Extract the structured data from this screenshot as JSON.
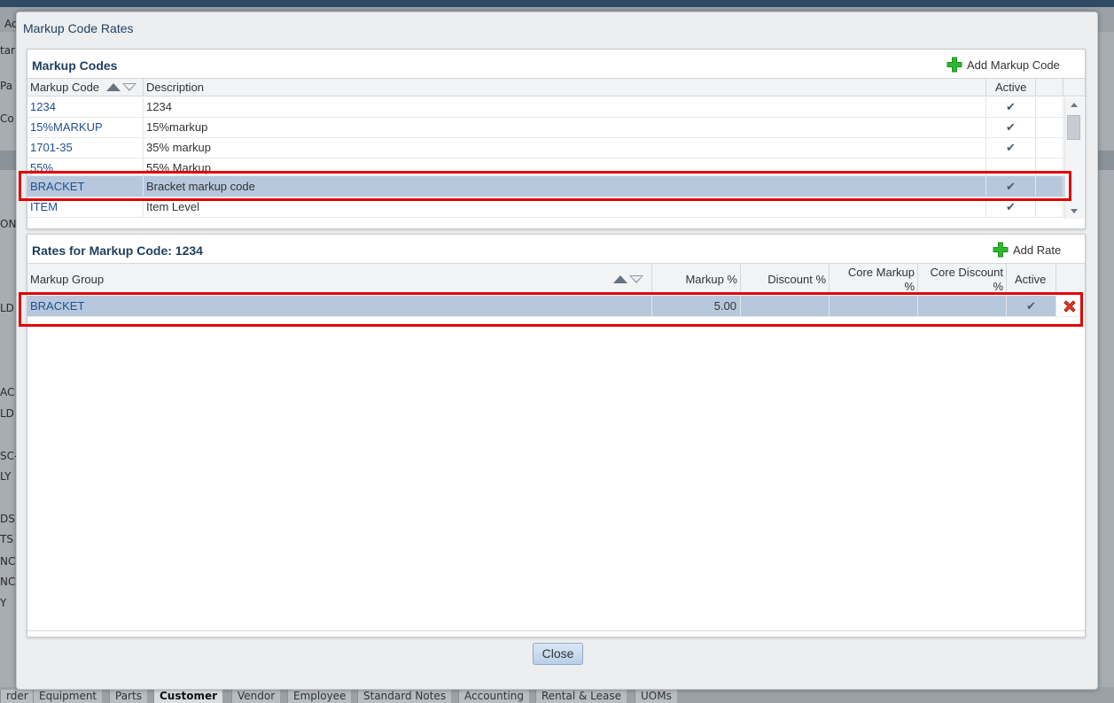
{
  "background": {
    "top_left_text": "Ac",
    "left_fragments": [
      "tar",
      "Pa",
      "Co",
      "ON",
      "LD",
      "AC",
      "LD",
      "SC-I",
      "LY",
      "DSM",
      "TS",
      "NC",
      "NC",
      "Y"
    ],
    "bottom_tabs": [
      "rder",
      "Equipment",
      "Parts",
      "Customer",
      "Vendor",
      "Employee",
      "Standard Notes",
      "Accounting",
      "Rental & Lease",
      "UOMs"
    ],
    "active_tab": "Customer"
  },
  "dialog": {
    "title": "Markup Code Rates",
    "close_label": "Close"
  },
  "markup_codes": {
    "title": "Markup Codes",
    "add_label": "Add Markup Code",
    "columns": {
      "code": "Markup Code",
      "description": "Description",
      "active": "Active"
    },
    "rows": [
      {
        "code": "1234",
        "description": "1234",
        "active": "✔"
      },
      {
        "code": "15%MARKUP",
        "description": "15%markup",
        "active": "✔"
      },
      {
        "code": "1701-35",
        "description": "35% markup",
        "active": "✔"
      },
      {
        "code": "55%",
        "description": "55% Markup",
        "active": ""
      },
      {
        "code": "BRACKET",
        "description": "Bracket markup code",
        "active": "✔",
        "selected": true
      },
      {
        "code": "ITEM",
        "description": "Item Level",
        "active": "✔"
      }
    ]
  },
  "rates": {
    "title": "Rates for Markup Code: 1234",
    "add_label": "Add Rate",
    "columns": {
      "group": "Markup Group",
      "markup": "Markup %",
      "discount": "Discount %",
      "core_markup_1": "Core Markup",
      "core_markup_2": "%",
      "core_discount_1": "Core Discount",
      "core_discount_2": "%",
      "active": "Active"
    },
    "rows": [
      {
        "group": "BRACKET",
        "markup": "5.00",
        "discount": "",
        "core_markup": "",
        "core_discount": "",
        "active": "✔"
      }
    ]
  },
  "colors": {
    "accent_red": "#e00000",
    "selected_row": "#b7c8dd",
    "title_blue": "#1c3f5e",
    "link_blue": "#1f4f8f",
    "plus_green": "#2eb82e"
  }
}
